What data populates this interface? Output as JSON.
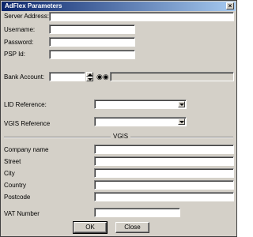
{
  "window": {
    "title": "AdFlex Parameters",
    "close_label": "×"
  },
  "fields": {
    "server_address": {
      "label": "Server Address:",
      "value": ""
    },
    "username": {
      "label": "Username:",
      "value": ""
    },
    "password": {
      "label": "Password:",
      "value": ""
    },
    "psp_id": {
      "label": "PSP Id:",
      "value": ""
    },
    "bank_account": {
      "label": "Bank Account:",
      "value": ""
    },
    "lid_reference": {
      "label": "LID Reference:",
      "value": ""
    },
    "vgis_reference": {
      "label": "VGIS Reference",
      "value": ""
    }
  },
  "vgis": {
    "group_title": "VGIS",
    "company_name": {
      "label": "Company name",
      "value": ""
    },
    "street": {
      "label": "Street",
      "value": ""
    },
    "city": {
      "label": "City",
      "value": ""
    },
    "country": {
      "label": "Country",
      "value": ""
    },
    "postcode": {
      "label": "Postcode",
      "value": ""
    },
    "vat_number": {
      "label": "VAT Number",
      "value": ""
    }
  },
  "buttons": {
    "ok": "OK",
    "close": "Close"
  },
  "icons": {
    "binoculars": "binoculars-icon"
  }
}
